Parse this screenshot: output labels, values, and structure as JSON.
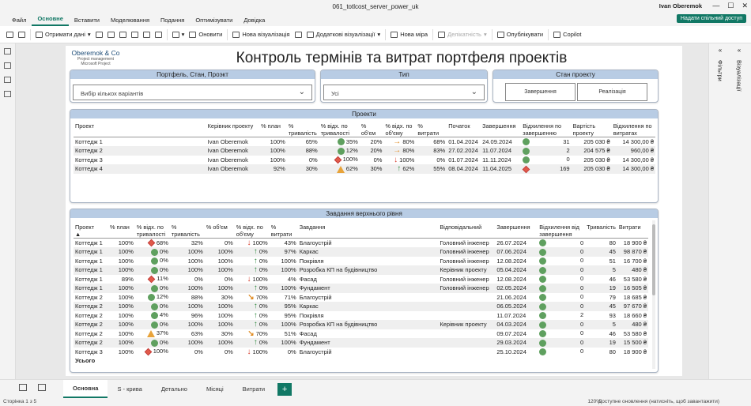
{
  "window": {
    "title": "061_totlcost_server_power_uk",
    "user": "Ivan Oberemok"
  },
  "menu": [
    "Файл",
    "Основне",
    "Вставити",
    "Моделювання",
    "Подання",
    "Оптимізувати",
    "Довідка"
  ],
  "share_label": "Надати спільний доступ",
  "ribbon": {
    "get_data": "Отримати дані",
    "refresh": "Оновити",
    "new_visual": "Нова візуалізація",
    "more_visuals": "Додаткові візуалізації",
    "new_measure": "Нова міра",
    "sensitivity": "Делікатність",
    "publish": "Опублікувати",
    "copilot": "Copilot"
  },
  "right_pane": {
    "filters": "Фільтри",
    "visualizations": "Візуалізації",
    "data": "Дані"
  },
  "report": {
    "logo": {
      "name": "Oberemok & Co",
      "line2": "Project management",
      "line3": "Microsoft Project"
    },
    "title": "Контроль термінів та витрат портфеля проектів",
    "slicer1": {
      "title": "Портфель, Стан, Проэкт",
      "value": "Вибір кількох варіантів"
    },
    "slicer2": {
      "title": "Тип",
      "value": "Усі"
    },
    "slicer3": {
      "title": "Стан проекту",
      "btn1": "Завершення",
      "btn2": "Реалізація"
    },
    "projects": {
      "title": "Проекти",
      "headers": [
        "Проект",
        "Керівник проекту",
        "% план",
        "% тривалість",
        "% відх. по тривалості",
        "% об'єм",
        "% відх. по об'єму",
        "% витрати",
        "Початок",
        "Завершення",
        "Відхилення по завершенню",
        "Вартість проекту",
        "Відхилення по витратах"
      ],
      "rows": [
        {
          "p": "Коттедж 1",
          "m": "Ivan Oberemok",
          "plan": "100%",
          "dur": "65%",
          "s1": "g",
          "d1": "35%",
          "vol": "20%",
          "a": "rt",
          "d2": "80%",
          "cost": "68%",
          "start": "01.04.2024",
          "end": "24.09.2024",
          "s2": "g",
          "dev": "31",
          "val": "205 030 ₴",
          "dc": "14 300,00 ₴"
        },
        {
          "p": "Коттедж 2",
          "m": "Ivan Oberemok",
          "plan": "100%",
          "dur": "88%",
          "s1": "g",
          "d1": "12%",
          "vol": "20%",
          "a": "rt",
          "d2": "80%",
          "cost": "83%",
          "start": "27.02.2024",
          "end": "11.07.2024",
          "s2": "g",
          "dev": "2",
          "val": "204 575 ₴",
          "dc": "960,00 ₴"
        },
        {
          "p": "Коттедж 3",
          "m": "Ivan Oberemok",
          "plan": "100%",
          "dur": "0%",
          "s1": "r",
          "d1": "100%",
          "vol": "0%",
          "a": "dn",
          "d2": "100%",
          "cost": "0%",
          "start": "01.07.2024",
          "end": "11.11.2024",
          "s2": "g",
          "dev": "0",
          "val": "205 030 ₴",
          "dc": "14 300,00 ₴"
        },
        {
          "p": "Коттедж 4",
          "m": "Ivan Oberemok",
          "plan": "92%",
          "dur": "30%",
          "s1": "y",
          "d1": "62%",
          "vol": "30%",
          "a": "up",
          "d2": "62%",
          "cost": "55%",
          "start": "08.04.2024",
          "end": "11.04.2025",
          "s2": "r",
          "dev": "169",
          "val": "205 030 ₴",
          "dc": "14 300,00 ₴"
        }
      ]
    },
    "tasks": {
      "title": "Завдання верхнього рівня",
      "headers": [
        "Проект",
        "% план",
        "% відх. по тривалості",
        "% тривалість",
        "% об'єм",
        "% відх. по об'єму",
        "% витрати",
        "Завдання",
        "Відповідальний",
        "Завершення",
        "Відхилення від завершення",
        "Тривалість",
        "Витрати"
      ],
      "rows": [
        {
          "p": "Коттедж 1",
          "plan": "100%",
          "s1": "r",
          "d1": "68%",
          "dur": "32%",
          "vol": "0%",
          "a": "dn",
          "d2": "100%",
          "cost": "43%",
          "task": "Благоустрій",
          "resp": "Головний інженер",
          "end": "26.07.2024",
          "s2": "g",
          "dev": "0",
          "len": "80",
          "exp": "18 900 ₴"
        },
        {
          "p": "Коттедж 1",
          "plan": "100%",
          "s1": "g",
          "d1": "0%",
          "dur": "100%",
          "vol": "100%",
          "a": "up",
          "d2": "0%",
          "cost": "97%",
          "task": "Каркас",
          "resp": "Головний інженер",
          "end": "07.06.2024",
          "s2": "g",
          "dev": "0",
          "len": "45",
          "exp": "98 870 ₴"
        },
        {
          "p": "Коттедж 1",
          "plan": "100%",
          "s1": "g",
          "d1": "0%",
          "dur": "100%",
          "vol": "100%",
          "a": "up",
          "d2": "0%",
          "cost": "100%",
          "task": "Покрівля",
          "resp": "Головний інженер",
          "end": "12.08.2024",
          "s2": "g",
          "dev": "0",
          "len": "51",
          "exp": "16 700 ₴"
        },
        {
          "p": "Коттедж 1",
          "plan": "100%",
          "s1": "g",
          "d1": "0%",
          "dur": "100%",
          "vol": "100%",
          "a": "up",
          "d2": "0%",
          "cost": "100%",
          "task": "Розробка КП на будівництво",
          "resp": "Керівник проекту",
          "end": "05.04.2024",
          "s2": "g",
          "dev": "0",
          "len": "5",
          "exp": "480 ₴"
        },
        {
          "p": "Коттедж 1",
          "plan": "89%",
          "s1": "r",
          "d1": "11%",
          "dur": "0%",
          "vol": "0%",
          "a": "dn",
          "d2": "100%",
          "cost": "4%",
          "task": "Фасад",
          "resp": "Головний інженер",
          "end": "12.08.2024",
          "s2": "g",
          "dev": "0",
          "len": "46",
          "exp": "53 580 ₴"
        },
        {
          "p": "Коттедж 1",
          "plan": "100%",
          "s1": "g",
          "d1": "0%",
          "dur": "100%",
          "vol": "100%",
          "a": "up",
          "d2": "0%",
          "cost": "100%",
          "task": "Фундамент",
          "resp": "Головний інженер",
          "end": "02.05.2024",
          "s2": "g",
          "dev": "0",
          "len": "19",
          "exp": "16 505 ₴"
        },
        {
          "p": "Коттедж 2",
          "plan": "100%",
          "s1": "g",
          "d1": "12%",
          "dur": "88%",
          "vol": "30%",
          "a": "dr",
          "d2": "70%",
          "cost": "71%",
          "task": "Благоустрій",
          "resp": "",
          "end": "21.06.2024",
          "s2": "g",
          "dev": "0",
          "len": "79",
          "exp": "18 685 ₴"
        },
        {
          "p": "Коттедж 2",
          "plan": "100%",
          "s1": "g",
          "d1": "0%",
          "dur": "100%",
          "vol": "100%",
          "a": "up",
          "d2": "0%",
          "cost": "95%",
          "task": "Каркас",
          "resp": "",
          "end": "06.05.2024",
          "s2": "g",
          "dev": "0",
          "len": "45",
          "exp": "97 670 ₴"
        },
        {
          "p": "Коттедж 2",
          "plan": "100%",
          "s1": "g",
          "d1": "4%",
          "dur": "96%",
          "vol": "100%",
          "a": "up",
          "d2": "0%",
          "cost": "95%",
          "task": "Покрівля",
          "resp": "",
          "end": "11.07.2024",
          "s2": "g",
          "dev": "2",
          "len": "93",
          "exp": "18 660 ₴"
        },
        {
          "p": "Коттедж 2",
          "plan": "100%",
          "s1": "g",
          "d1": "0%",
          "dur": "100%",
          "vol": "100%",
          "a": "up",
          "d2": "0%",
          "cost": "100%",
          "task": "Розробка КП на будівництво",
          "resp": "Керівник проекту",
          "end": "04.03.2024",
          "s2": "g",
          "dev": "0",
          "len": "5",
          "exp": "480 ₴"
        },
        {
          "p": "Коттедж 2",
          "plan": "100%",
          "s1": "y",
          "d1": "37%",
          "dur": "63%",
          "vol": "30%",
          "a": "dr",
          "d2": "70%",
          "cost": "51%",
          "task": "Фасад",
          "resp": "",
          "end": "09.07.2024",
          "s2": "g",
          "dev": "0",
          "len": "46",
          "exp": "53 580 ₴"
        },
        {
          "p": "Коттедж 2",
          "plan": "100%",
          "s1": "g",
          "d1": "0%",
          "dur": "100%",
          "vol": "100%",
          "a": "up",
          "d2": "0%",
          "cost": "100%",
          "task": "Фундамент",
          "resp": "",
          "end": "29.03.2024",
          "s2": "g",
          "dev": "0",
          "len": "19",
          "exp": "15 500 ₴"
        },
        {
          "p": "Коттедж 3",
          "plan": "100%",
          "s1": "r",
          "d1": "100%",
          "dur": "0%",
          "vol": "0%",
          "a": "dn",
          "d2": "100%",
          "cost": "0%",
          "task": "Благоустрій",
          "resp": "",
          "end": "25.10.2024",
          "s2": "g",
          "dev": "0",
          "len": "80",
          "exp": "18 900 ₴"
        }
      ],
      "total": "Усього"
    }
  },
  "page_tabs": [
    "Основна",
    "S - крива",
    "Детально",
    "Місяці",
    "Витрати"
  ],
  "status": {
    "page": "Сторінка 1 з 5",
    "zoom": "120%",
    "update": "Доступне оновлення (натисніть, щоб завантажити)"
  }
}
